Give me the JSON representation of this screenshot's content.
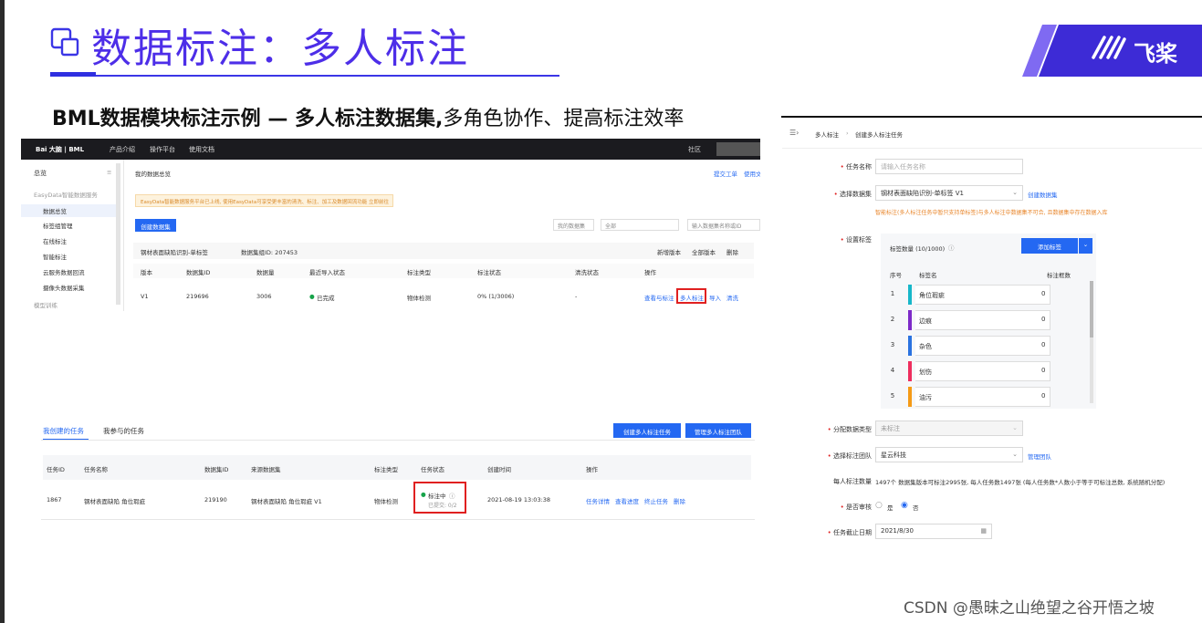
{
  "slide": {
    "title": "数据标注：多人标注",
    "subtitle_bold": "BML数据模块标注示例 — 多人标注数据集,",
    "subtitle_rest": "多角色协作、提高标注效率",
    "logo_text": "飞桨",
    "footer": "CSDN @愚昧之山绝望之谷开悟之坡"
  },
  "shot1": {
    "brand": "Bai 大脑 | BML",
    "nav": [
      "产品介绍",
      "操作平台",
      "使用文档"
    ],
    "top_right": "社区",
    "side_overview": "总览",
    "side_items": [
      "EasyData智能数据服务",
      "数据总览",
      "标签组管理",
      "在线标注",
      "智能标注",
      "云服务数据回流",
      "摄像头数据采集",
      "模型训练"
    ],
    "breadcrumb": "我的数据总览",
    "top_links": [
      "提交工单",
      "使用文"
    ],
    "warning": "EasyData智能数据服务平台已上线, 使用EasyData可享受更丰富的清洗、标注、加工及数据回流功能 立即前往",
    "create_button": "创建数据集",
    "filter_select": "我的数据集",
    "type_select": "全部",
    "search_placeholder": "输入数据集名称或ID",
    "dataset_name": "钢材表面缺陷识别-单标签",
    "group_id": "数据集组ID: 207453",
    "actions": [
      "新增版本",
      "全部版本",
      "删除"
    ],
    "columns": [
      "版本",
      "数据集ID",
      "数据量",
      "最近导入状态",
      "标注类型",
      "标注状态",
      "清洗状态",
      "操作"
    ],
    "row": {
      "version": "V1",
      "id": "219696",
      "count": "3006",
      "import": "已完成",
      "type": "物体检测",
      "status": "0% (1/3006)",
      "clean": "-"
    },
    "row_ops": [
      "查看与标注",
      "多人标注",
      "导入",
      "清洗"
    ]
  },
  "shot2": {
    "tabs": [
      "我创建的任务",
      "我参与的任务"
    ],
    "buttons": [
      "创建多人标注任务",
      "管理多人标注团队"
    ],
    "columns": [
      "任务ID",
      "任务名称",
      "数据集ID",
      "来源数据集",
      "标注类型",
      "任务状态",
      "创建时间",
      "操作"
    ],
    "row": {
      "id": "1867",
      "name": "钢材表面缺陷 角位瑕疵",
      "dataset_id": "219190",
      "source": "钢材表面缺陷 角位瑕疵 V1",
      "type": "物体检测",
      "status": "标注中",
      "submitted": "已提交: 0/2",
      "time": "2021-08-19 13:03:38",
      "ops": [
        "任务详情",
        "查看进度",
        "终止任务",
        "删除"
      ]
    }
  },
  "shot3": {
    "breadcrumb_a": "多人标注",
    "breadcrumb_b": "创建多人标注任务",
    "task_name_label": "任务名称",
    "task_name_placeholder": "请输入任务名称",
    "dataset_label": "选择数据集",
    "dataset_value": "钢材表面缺陷识别-单标签 V1",
    "create_dataset": "创建数据集",
    "hint": "智能标注(多人标注任务中暂只支持单标签)与多人标注中数据集不可合, 且数据集中存在数据入库",
    "tag_label": "设置标签",
    "tag_count": "标签数量 (10/1000)",
    "add_tag": "添加标签",
    "tag_cols": [
      "序号",
      "标签名",
      "标注框数"
    ],
    "tags": [
      {
        "n": "1",
        "name": "角位瑕疵",
        "count": "0",
        "color": "#17b7c9"
      },
      {
        "n": "2",
        "name": "边痕",
        "count": "0",
        "color": "#7d2ac8"
      },
      {
        "n": "3",
        "name": "杂色",
        "count": "0",
        "color": "#2a72e0"
      },
      {
        "n": "4",
        "name": "划伤",
        "count": "0",
        "color": "#ee2e5e"
      },
      {
        "n": "5",
        "name": "油污",
        "count": "0",
        "color": "#f59a16"
      }
    ],
    "dist_label": "分配数据类型",
    "dist_value": "未标注",
    "team_label": "选择标注团队",
    "team_value": "星云科技",
    "manage_team": "管理团队",
    "per_label": "每人标注数量",
    "per_text": "1497个 数据集版本可标注2995张, 每人任务数1497张 (每人任务数*人数小于等于可标注总数, 系统随机分配)",
    "review_label": "是否审核",
    "review_yes": "是",
    "review_no": "否",
    "deadline_label": "任务截止日期",
    "deadline_value": "2021/8/30"
  }
}
